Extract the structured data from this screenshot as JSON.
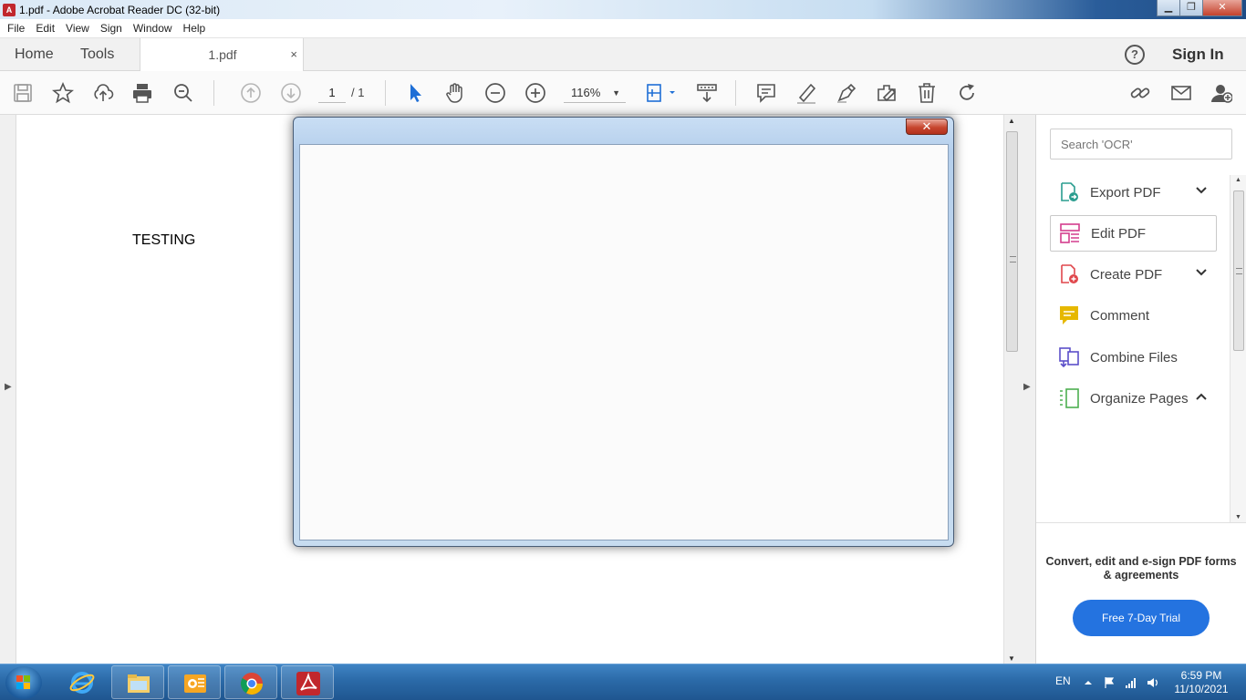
{
  "window": {
    "title": "1.pdf - Adobe Acrobat Reader DC (32-bit)",
    "minimize": "▁",
    "maximize": "❐",
    "close": "✕"
  },
  "menu": [
    "File",
    "Edit",
    "View",
    "Sign",
    "Window",
    "Help"
  ],
  "tabs": {
    "home": "Home",
    "tools": "Tools",
    "document": "1.pdf",
    "close": "×"
  },
  "header": {
    "help": "?",
    "sign_in": "Sign In"
  },
  "toolbar": {
    "page_current": "1",
    "page_total": "/ 1",
    "zoom": "116%",
    "zoom_caret": "▼"
  },
  "document": {
    "text": "TESTING"
  },
  "dialog": {
    "close": "✕"
  },
  "right_panel": {
    "search_placeholder": "Search 'OCR'",
    "tools": [
      {
        "label": "Export PDF",
        "icon": "export-pdf-icon",
        "chevron": "down",
        "color": "#2a9d8f"
      },
      {
        "label": "Edit PDF",
        "icon": "edit-pdf-icon",
        "selected": true,
        "color": "#d43d8e"
      },
      {
        "label": "Create PDF",
        "icon": "create-pdf-icon",
        "chevron": "down",
        "color": "#e0474c"
      },
      {
        "label": "Comment",
        "icon": "comment-icon",
        "color": "#e6b800"
      },
      {
        "label": "Combine Files",
        "icon": "combine-files-icon",
        "color": "#5b4fc9"
      },
      {
        "label": "Organize Pages",
        "icon": "organize-pages-icon",
        "chevron": "up",
        "color": "#4caf50"
      }
    ],
    "promo": "Convert, edit and e-sign PDF forms & agreements",
    "trial_button": "Free 7-Day Trial"
  },
  "taskbar": {
    "language": "EN",
    "time": "6:59 PM",
    "date": "11/10/2021",
    "apps": [
      "internet-explorer-icon",
      "file-explorer-icon",
      "outlook-icon",
      "chrome-icon",
      "acrobat-icon"
    ]
  },
  "colors": {
    "accent": "#2473e0",
    "acrobat_red": "#c1272d",
    "taskbar": "#2b6aa8"
  }
}
